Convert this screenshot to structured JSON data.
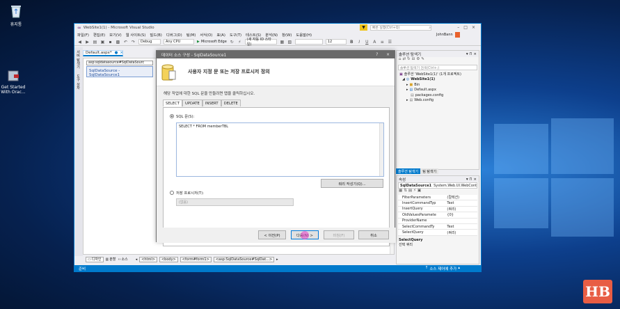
{
  "desktop": {
    "icons": [
      {
        "label": "휴지통",
        "icon": "recycle-bin-icon"
      },
      {
        "label": "Get Started With Orac...",
        "icon": "oracle-installer-icon"
      }
    ]
  },
  "vs": {
    "title": "WebSite1(1) - Microsoft Visual Studio",
    "quick_launch": "빠른 실행(Ctrl+Q)",
    "user": "JohnBann",
    "menu": [
      "파일(F)",
      "편집(E)",
      "보기(V)",
      "웹 사이트(S)",
      "빌드(B)",
      "디버그(D)",
      "팀(M)",
      "서식(O)",
      "표(A)",
      "도구(T)",
      "테스트(S)",
      "분석(N)",
      "창(W)",
      "도움말(H)"
    ],
    "toolbar": {
      "config": "Debug",
      "platform": "Any CPU",
      "browser": "Microsoft Edge",
      "block": "(새 자동 ID 스타일)",
      "font_size": "12"
    },
    "side_tabs": [
      "서버 탐색기",
      "도구 상자"
    ],
    "doc_tab": "Default.aspx*",
    "editor": {
      "crumb": "asp:sqldatasource#SqlDataSourc",
      "control": "SqlDataSource - SqlDataSource1"
    },
    "editor_bottom": {
      "views": [
        "디자인",
        "분할",
        "소스"
      ],
      "path": [
        "<html>",
        "<body>",
        "<form#form1>",
        "<asp:SqlDataSource#SqlDat...>"
      ]
    },
    "status": {
      "left": "준비",
      "right": "소스 제어에 추가"
    },
    "solution_explorer": {
      "title": "솔루션 탐색기",
      "search_placeholder": "솔루션 탐색기 검색(Ctrl+;)",
      "items": [
        "솔루션 'WebSite1(1)' (1개 프로젝트)",
        "WebSite1(1)",
        "Bin",
        "Default.aspx",
        "packages.config",
        "Web.config"
      ],
      "tabs": [
        "솔루션 탐색기",
        "팀 탐색기"
      ]
    },
    "properties": {
      "title": "속성",
      "object": "SqlDataSource1",
      "type": "System.Web.UI.WebContr",
      "rows": [
        {
          "k": "FilterParameters",
          "v": "(컬렉션)"
        },
        {
          "k": "InsertCommandTyp",
          "v": "Text"
        },
        {
          "k": "InsertQuery",
          "v": "(쿼리)"
        },
        {
          "k": "OldValuesParamete",
          "v": "{0}"
        },
        {
          "k": "ProviderName",
          "v": ""
        },
        {
          "k": "SelectCommandTy",
          "v": "Text"
        },
        {
          "k": "SelectQuery",
          "v": "(쿼리)"
        }
      ],
      "desc_title": "SelectQuery",
      "desc_text": "선택 쿼리"
    }
  },
  "dialog": {
    "title": "데이터 소스 구성 - SqlDataSource1",
    "heading": "사용자 지정 문 또는 저장 프로시저 정의",
    "description": "해당 작업에 대한 SQL 문을 만들려면 탭을 클릭하십시오.",
    "tabs": [
      "SELECT",
      "UPDATE",
      "INSERT",
      "DELETE"
    ],
    "sql_radio": "SQL 문(S):",
    "sql_text": "SELECT * FROM memberTBL",
    "query_builder": "쿼리 작성기(Q)...",
    "proc_radio": "저장 프로시저(T):",
    "proc_value": "(없음)",
    "buttons": {
      "prev": "< 이전(P)",
      "next": "다음(N) >",
      "finish": "마침(F)",
      "cancel": "취소"
    },
    "close": "×",
    "help": "?"
  },
  "watermark": "HB"
}
